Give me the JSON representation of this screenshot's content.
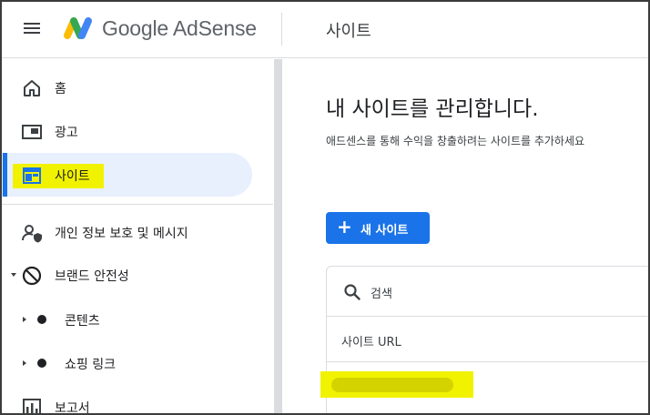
{
  "header": {
    "brand": "Google AdSense",
    "page_title": "사이트"
  },
  "sidebar": {
    "items": [
      {
        "label": "홈",
        "icon": "home-icon"
      },
      {
        "label": "광고",
        "icon": "ads-icon"
      },
      {
        "label": "사이트",
        "icon": "sites-icon",
        "active": true
      },
      {
        "label": "개인 정보 보호 및 메시지",
        "icon": "privacy-messaging-icon"
      },
      {
        "label": "브랜드 안전성",
        "icon": "block-icon",
        "expanded": true
      },
      {
        "label": "콘텐츠",
        "icon": "dot-icon"
      },
      {
        "label": "쇼핑 링크",
        "icon": "dot-icon"
      },
      {
        "label": "보고서",
        "icon": "bar-chart-icon"
      }
    ]
  },
  "main": {
    "title": "내 사이트를 관리합니다.",
    "subtitle": "애드센스를 통해 수익을 창출하려는 사이트를 추가하세요",
    "new_site_label": "새 사이트",
    "search_placeholder": "검색",
    "column_site_url": "사이트 URL"
  },
  "colors": {
    "accent": "#1a73e8",
    "active_bg": "#e8f0fe",
    "highlight": "#f1f200"
  }
}
